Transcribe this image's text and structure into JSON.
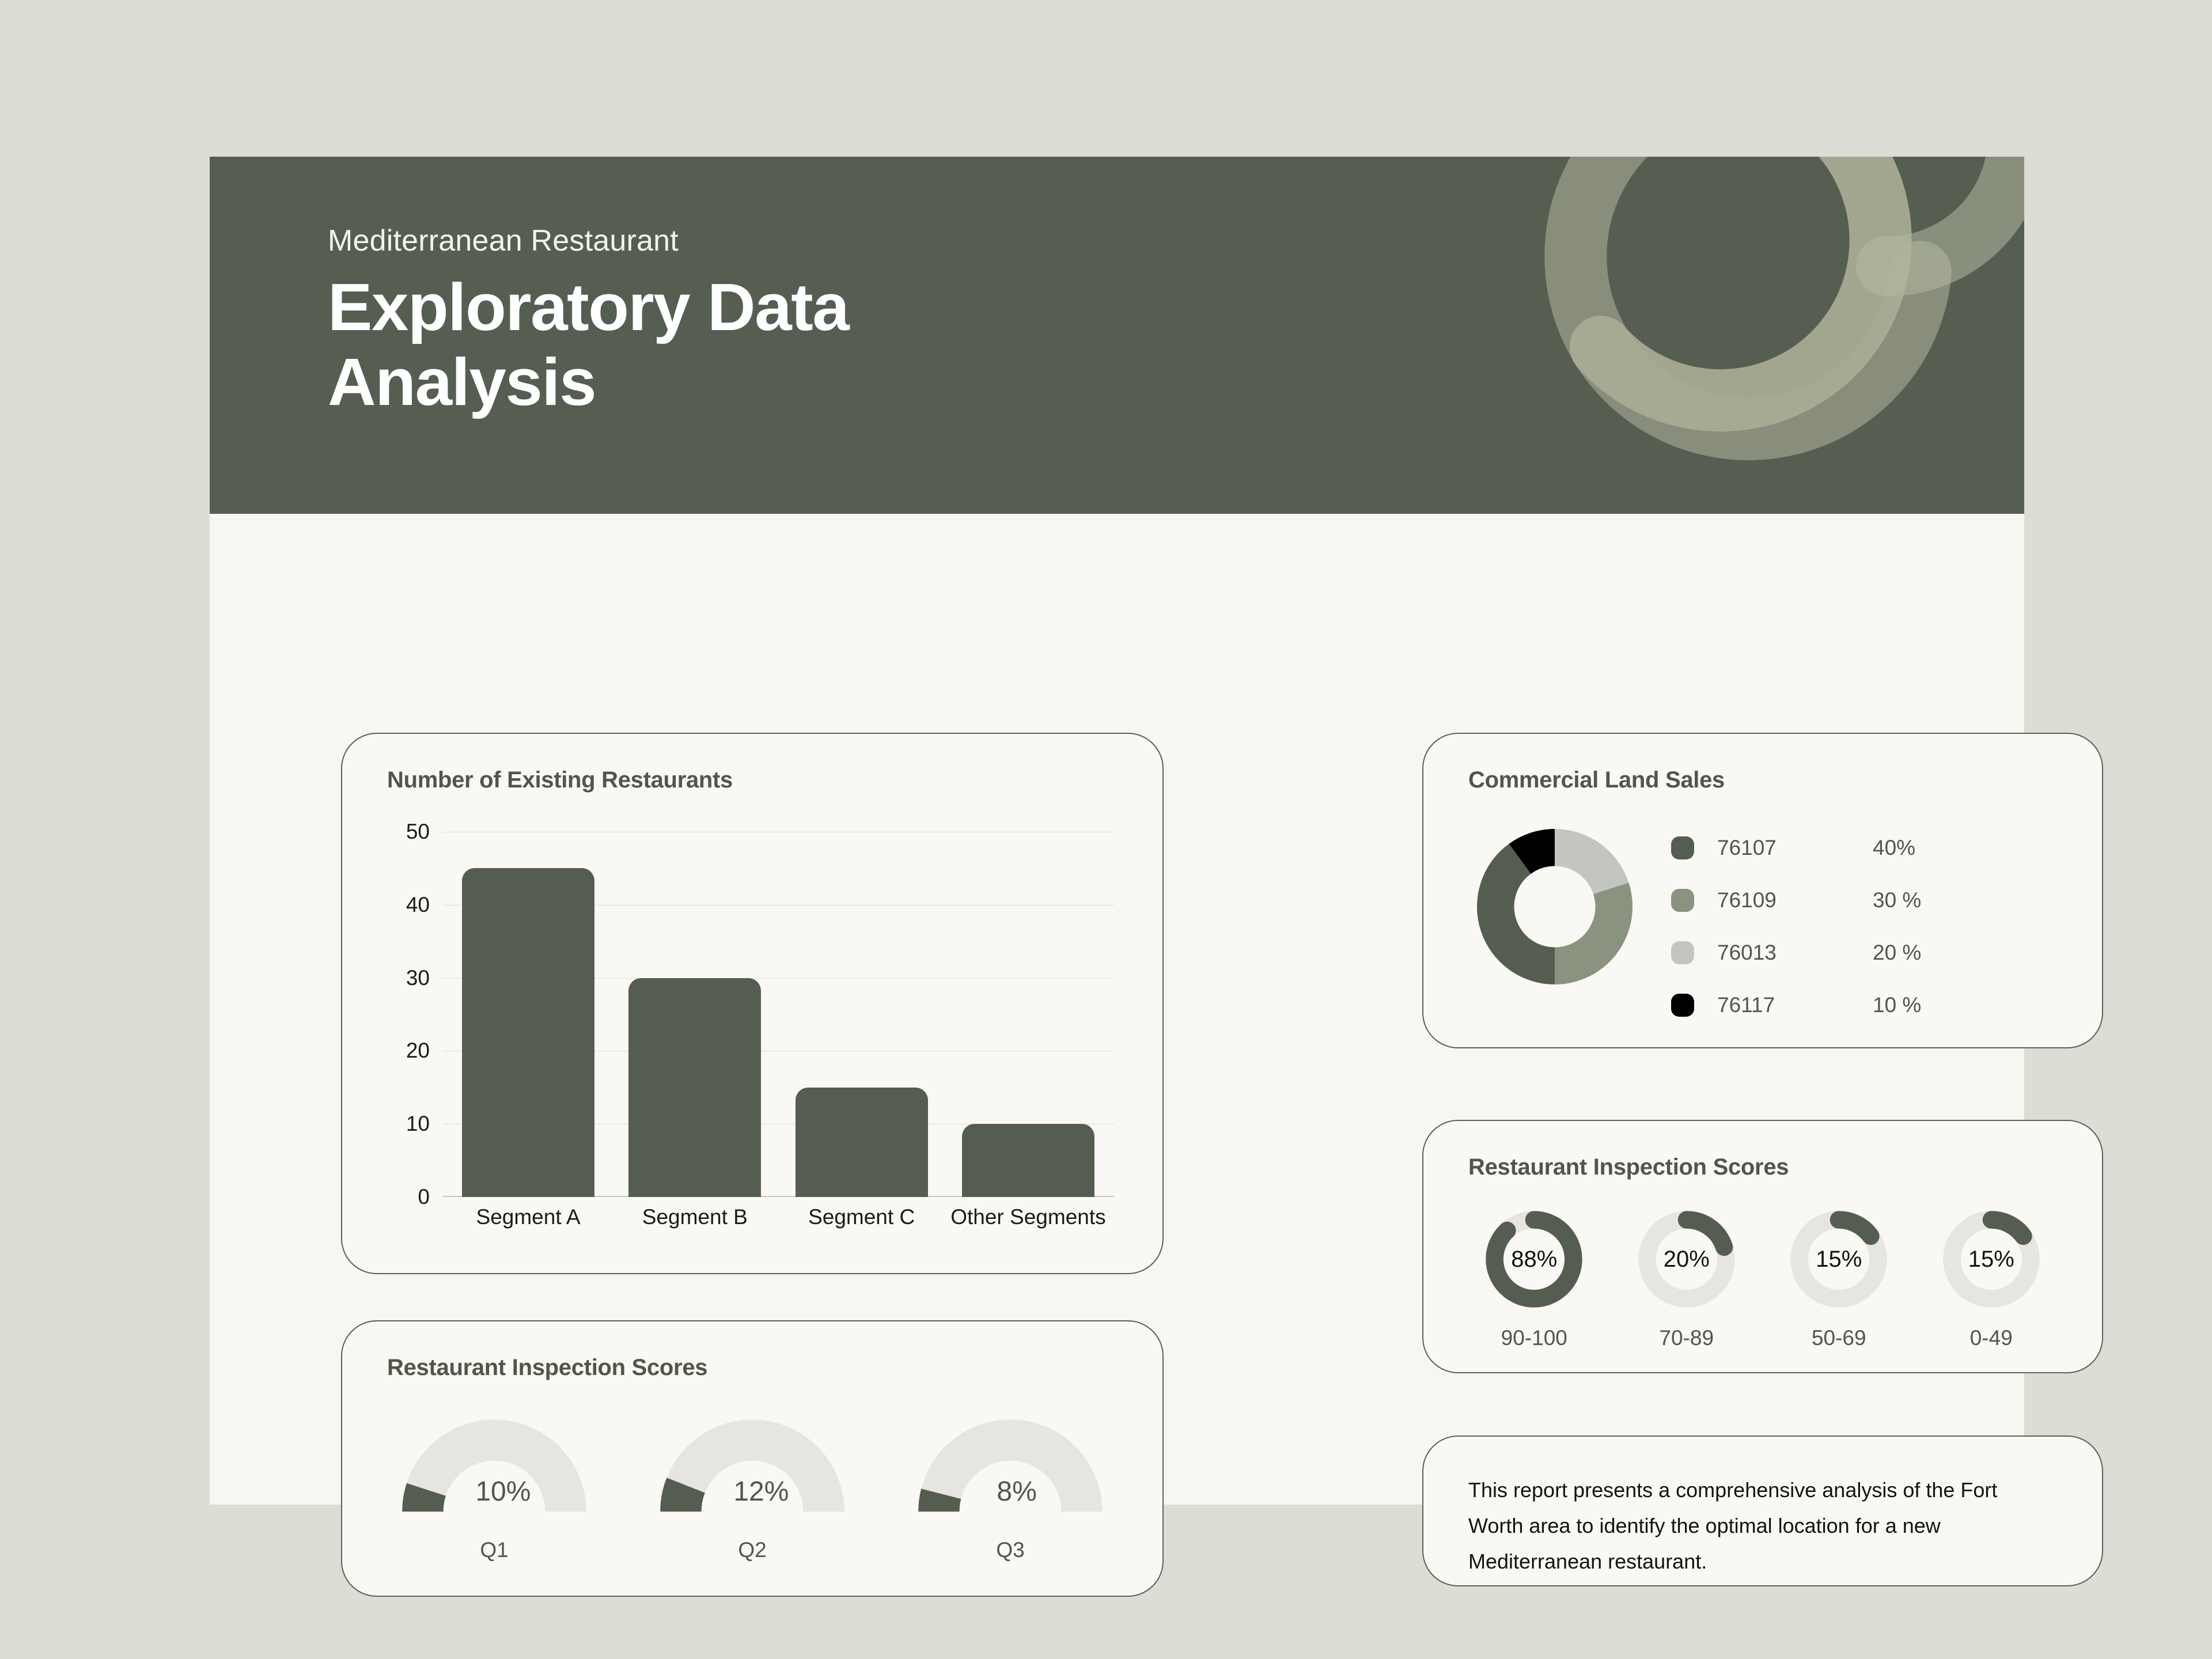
{
  "header": {
    "eyebrow": "Mediterranean Restaurant",
    "title_line1": "Exploratory Data",
    "title_line2": "Analysis",
    "background_color": "#565e52",
    "decoration": "spiral-swirl"
  },
  "colors": {
    "page_background": "#dcddd5",
    "sheet_background": "#f7f6f1",
    "card_background": "#f9f8f4",
    "card_border": "#5b6254",
    "dark_green": "#555d50",
    "sage": "#8a9280",
    "light_gray": "#c3c6bf",
    "black": "#000000",
    "gauge_track": "#e6e5e1",
    "title_text": "#4f5749"
  },
  "cards": {
    "bar": {
      "title": "Number of Existing Restaurants"
    },
    "donut": {
      "title": "Commercial Land Sales"
    },
    "gauges": {
      "title": "Restaurant Inspection Scores"
    },
    "halfgauges": {
      "title": "Restaurant Inspection Scores"
    },
    "note": {
      "text": "This report presents a comprehensive analysis of the Fort Worth area to identify the optimal location for a new Mediterranean restaurant."
    }
  },
  "chart_data": [
    {
      "type": "bar",
      "title": "Number of Existing Restaurants",
      "categories": [
        "Segment A",
        "Segment B",
        "Segment C",
        "Other Segments"
      ],
      "values": [
        45,
        30,
        15,
        10
      ],
      "xlabel": "",
      "ylabel": "",
      "ylim": [
        0,
        50
      ],
      "yticks": [
        0,
        10,
        20,
        30,
        40,
        50
      ],
      "ytick_labels": [
        "0",
        "10",
        "20",
        "30",
        "40",
        "50"
      ],
      "grid": true,
      "legend": false,
      "bar_color": "#555d50"
    },
    {
      "type": "pie",
      "title": "Commercial Land Sales",
      "variant": "donut",
      "legend_position": "right",
      "labels": [
        "76107",
        "76109",
        "76013",
        "76117"
      ],
      "values": [
        40,
        30,
        20,
        10
      ],
      "value_labels": [
        "40%",
        "30 %",
        "20 %",
        "10 %"
      ],
      "colors": [
        "#555d50",
        "#8a9280",
        "#c3c6bf",
        "#000000"
      ],
      "slice_order_clockwise_from_top": [
        "76013",
        "76109",
        "76107",
        "76117"
      ]
    },
    {
      "type": "bar",
      "variant": "radial-gauge",
      "title": "Restaurant Inspection Scores",
      "categories": [
        "90-100",
        "70-89",
        "50-69",
        "0-49"
      ],
      "values": [
        88,
        20,
        15,
        15
      ],
      "value_labels": [
        "88%",
        "20%",
        "15%",
        "15%"
      ],
      "ylim": [
        0,
        100
      ],
      "fill_color": "#555d50",
      "track_color": "#e6e5e1"
    },
    {
      "type": "bar",
      "variant": "semicircle-gauge",
      "title": "Restaurant Inspection Scores",
      "categories": [
        "Q1",
        "Q2",
        "Q3"
      ],
      "values": [
        10,
        12,
        8
      ],
      "value_labels": [
        "10%",
        "12%",
        "8%"
      ],
      "ylim": [
        0,
        100
      ],
      "fill_color": "#555d50",
      "track_color": "#e6e5e1"
    }
  ]
}
